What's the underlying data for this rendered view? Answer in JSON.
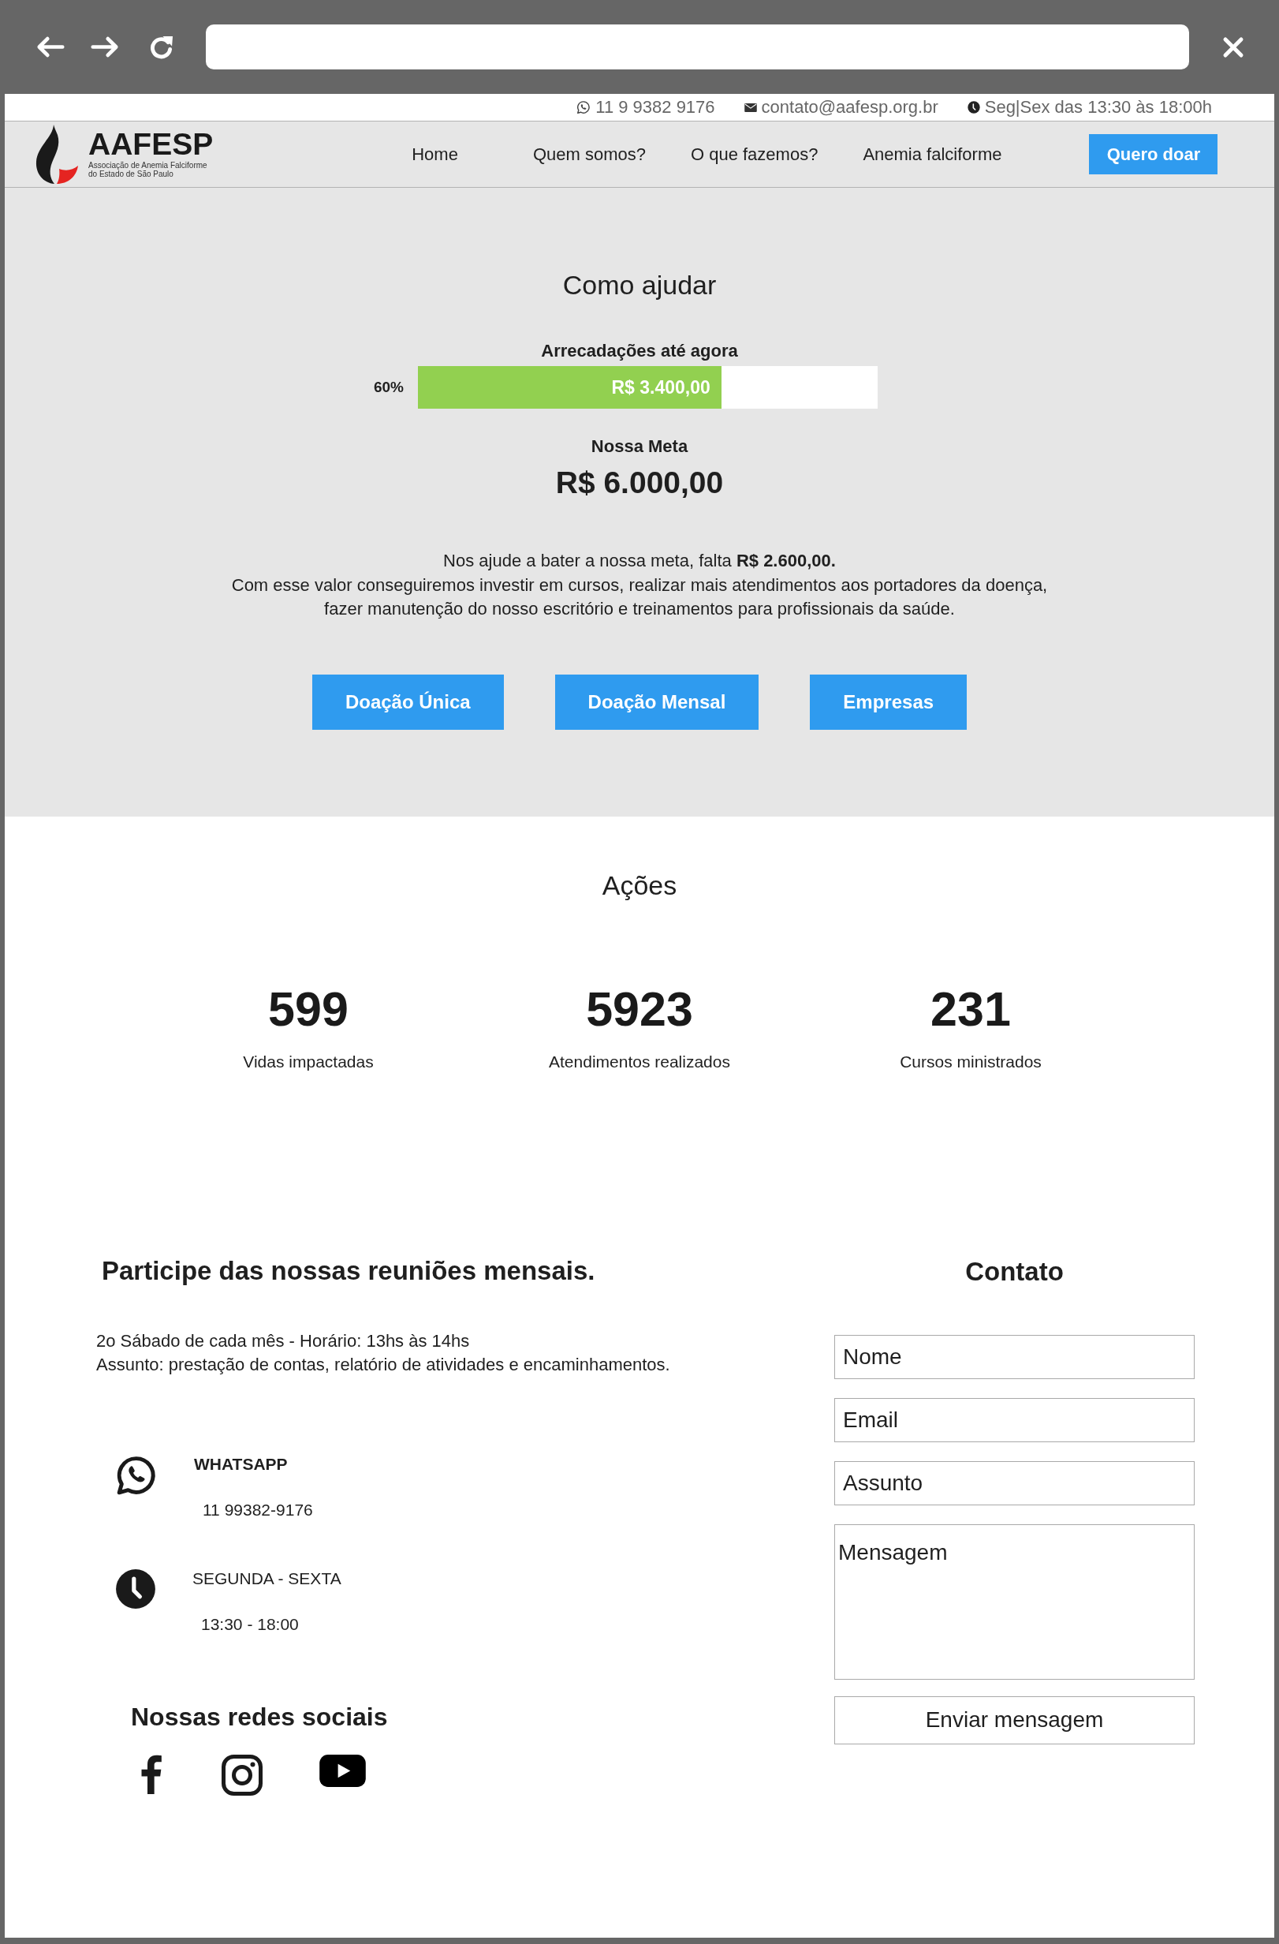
{
  "top_bar": {
    "items": [
      {
        "kind": "whatsapp",
        "text": "11 9 9382 9176"
      },
      {
        "kind": "email",
        "text": "contato@aafesp.org.br"
      },
      {
        "kind": "hours",
        "text": "Seg|Sex das 13:30 às 18:00h"
      }
    ]
  },
  "navbar": {
    "logo": {
      "name": "AAFESP",
      "tagline": [
        "Associação de Anemia Falciforme",
        "do Estado de São Paulo"
      ]
    },
    "links": [
      "Home",
      "Quem somos?",
      "O que fazemos?",
      "Anemia falciforme"
    ],
    "cta": "Quero doar"
  },
  "donation": {
    "title": "Como ajudar",
    "progress": {
      "label": "Arrecadações até agora",
      "percent": "60%",
      "level": 0.66,
      "amount": "R$ 3.400,00"
    },
    "goal": {
      "label": "Nossa Meta",
      "amount": "R$ 6.000,00"
    },
    "message": [
      "Nos ajude a bater a nossa meta, falta **R$ 2.600,00.**",
      "Com esse valor conseguiremos investir em cursos, realizar mais atendimentos aos portadores da doença,",
      "fazer manutenção do nosso escritório e treinamentos para profissionais da saúde."
    ],
    "buttons": [
      "Doação Única",
      "Doação Mensal",
      "Empresas"
    ]
  },
  "actions": {
    "title": "Ações",
    "stats": [
      {
        "value": "599",
        "label": "Vidas impactadas"
      },
      {
        "value": "5923",
        "label": "Atendimentos realizados"
      },
      {
        "value": "231",
        "label": "Cursos ministrados"
      }
    ]
  },
  "meetings": {
    "title": "Participe das nossas reuniões mensais.",
    "details": [
      "2o Sábado de cada mês - Horário: 13hs às 14hs",
      "Assunto: prestação de contas, relatório de atividades e encaminhamentos."
    ],
    "contacts": [
      {
        "kind": "whatsapp",
        "title": "WHATSAPP",
        "bold": true,
        "detail": "11 99382-9176"
      },
      {
        "kind": "hours",
        "title": "SEGUNDA - SEXTA",
        "bold": false,
        "detail": "13:30 - 18:00"
      }
    ],
    "social_title": "Nossas redes sociais"
  },
  "contact_form": {
    "title": "Contato",
    "fields": [
      {
        "kind": "input",
        "placeholder": "Nome"
      },
      {
        "kind": "input",
        "placeholder": "Email"
      },
      {
        "kind": "input",
        "placeholder": "Assunto"
      },
      {
        "kind": "textarea",
        "placeholder": "Mensagem"
      }
    ],
    "submit": "Enviar mensagem"
  }
}
